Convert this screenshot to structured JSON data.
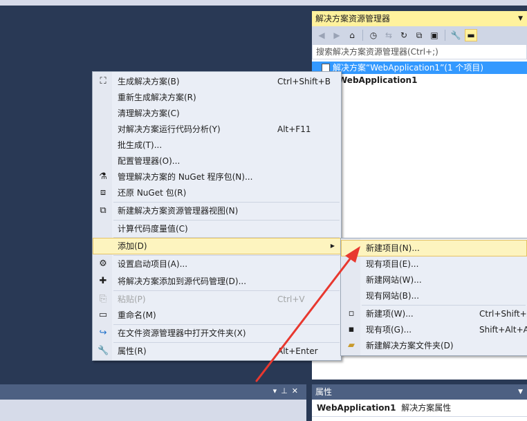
{
  "solution_explorer": {
    "title": "解决方案资源管理器",
    "search_placeholder": "搜索解决方案资源管理器(Ctrl+;)",
    "solution_label": "解决方案“WebApplication1”(1 个项目)",
    "project_label": "WebApplication1"
  },
  "context_menu": {
    "items": [
      {
        "label": "生成解决方案(B)",
        "shortcut": "Ctrl+Shift+B"
      },
      {
        "label": "重新生成解决方案(R)",
        "shortcut": ""
      },
      {
        "label": "清理解决方案(C)",
        "shortcut": ""
      },
      {
        "label": "对解决方案运行代码分析(Y)",
        "shortcut": "Alt+F11"
      },
      {
        "label": "批生成(T)...",
        "shortcut": ""
      },
      {
        "label": "配置管理器(O)...",
        "shortcut": ""
      },
      {
        "label": "管理解决方案的 NuGet 程序包(N)...",
        "shortcut": ""
      },
      {
        "label": "还原 NuGet 包(R)",
        "shortcut": ""
      },
      {
        "label": "新建解决方案资源管理器视图(N)",
        "shortcut": ""
      },
      {
        "label": "计算代码度量值(C)",
        "shortcut": ""
      },
      {
        "label": "添加(D)",
        "shortcut": ""
      },
      {
        "label": "设置启动项目(A)...",
        "shortcut": ""
      },
      {
        "label": "将解决方案添加到源代码管理(D)...",
        "shortcut": ""
      },
      {
        "label": "粘贴(P)",
        "shortcut": "Ctrl+V"
      },
      {
        "label": "重命名(M)",
        "shortcut": ""
      },
      {
        "label": "在文件资源管理器中打开文件夹(X)",
        "shortcut": ""
      },
      {
        "label": "属性(R)",
        "shortcut": "Alt+Enter"
      }
    ]
  },
  "submenu": {
    "items": [
      {
        "label": "新建项目(N)...",
        "shortcut": ""
      },
      {
        "label": "现有项目(E)...",
        "shortcut": ""
      },
      {
        "label": "新建网站(W)...",
        "shortcut": ""
      },
      {
        "label": "现有网站(B)...",
        "shortcut": ""
      },
      {
        "label": "新建项(W)...",
        "shortcut": "Ctrl+Shift+A"
      },
      {
        "label": "现有项(G)...",
        "shortcut": "Shift+Alt+A"
      },
      {
        "label": "新建解决方案文件夹(D)",
        "shortcut": ""
      }
    ]
  },
  "properties": {
    "title": "属性",
    "object_name": "WebApplication1",
    "object_type": "解决方案属性"
  },
  "colors": {
    "accent_yellow": "#fff29d",
    "selection_blue": "#3399ff",
    "background_navy": "#293955",
    "annotation_red": "#e8382f"
  }
}
